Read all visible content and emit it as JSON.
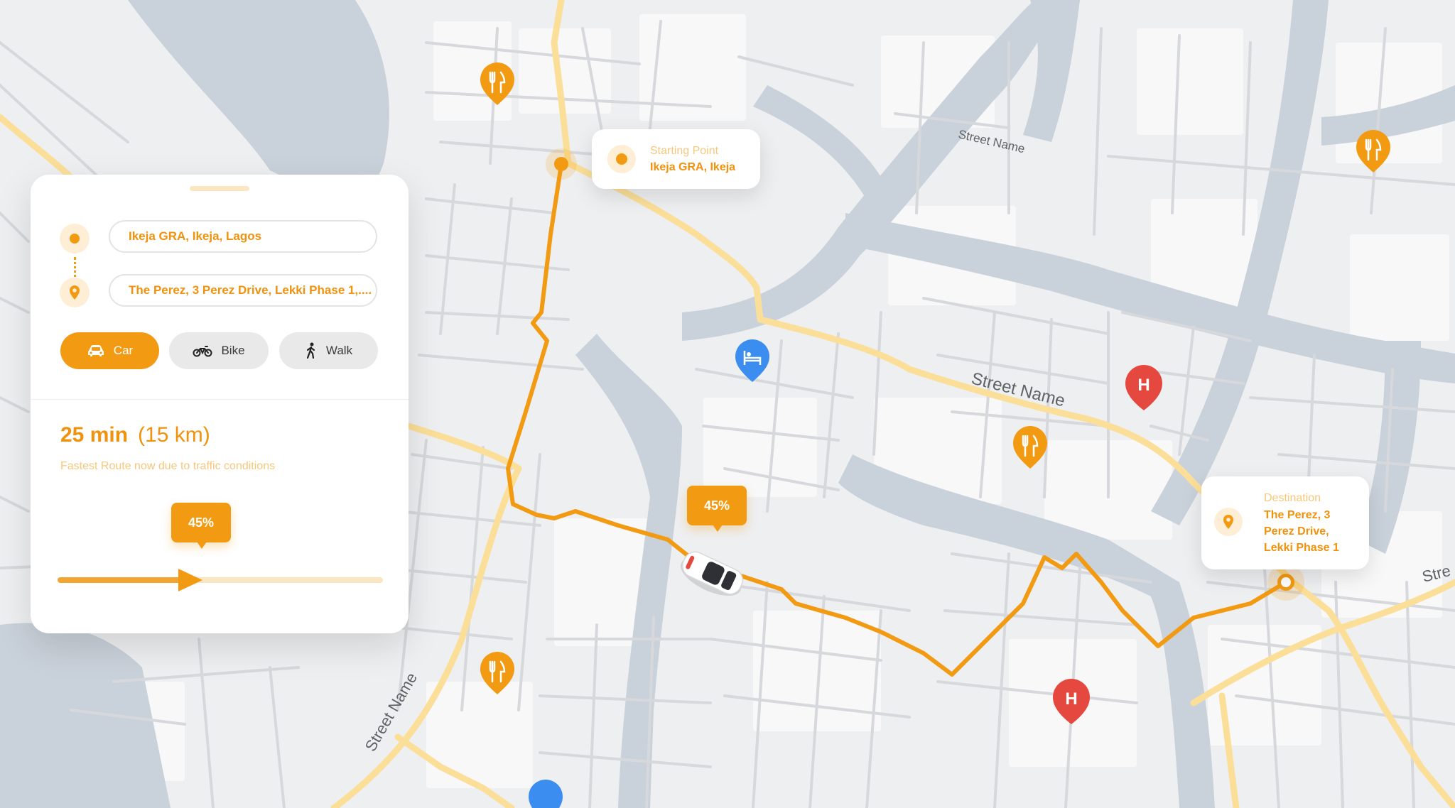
{
  "colors": {
    "accent": "#f29a12",
    "accent_light": "#fbe6c2",
    "route": "#f29a12",
    "major_road": "#fbdf98",
    "water": "#c9d1da",
    "land": "#eeeff1",
    "hospital": "#e5483f",
    "hotel": "#3b8ef0"
  },
  "panel": {
    "origin_value": "Ikeja GRA, Ikeja, Lagos",
    "destination_value": "The Perez, 3 Perez Drive, Lekki Phase 1,....",
    "origin_icon": "circle-dot-icon",
    "destination_icon": "map-pin-icon",
    "modes": [
      {
        "label": "Car",
        "icon": "car-icon",
        "active": true
      },
      {
        "label": "Bike",
        "icon": "motorbike-icon",
        "active": false
      },
      {
        "label": "Walk",
        "icon": "walking-person-icon",
        "active": false
      }
    ],
    "eta_time": "25 min",
    "eta_distance": "(15 km)",
    "eta_note": "Fastest Route now due to traffic conditions",
    "progress_label": "45%",
    "progress_fraction": 0.45
  },
  "map": {
    "start_callout": {
      "label": "Starting Point",
      "value": "Ikeja GRA, Ikeja"
    },
    "destination_callout": {
      "label": "Destination",
      "value_lines": [
        "The Perez, 3",
        "Perez Drive,",
        "Lekki Phase 1"
      ]
    },
    "car_progress_label": "45%",
    "street_labels": [
      "Street Name",
      "Street Name",
      "Street Name",
      "Stre"
    ],
    "poi_icons": [
      "restaurant-icon",
      "hotel-icon",
      "hospital-icon"
    ],
    "hospital_letter": "H"
  }
}
